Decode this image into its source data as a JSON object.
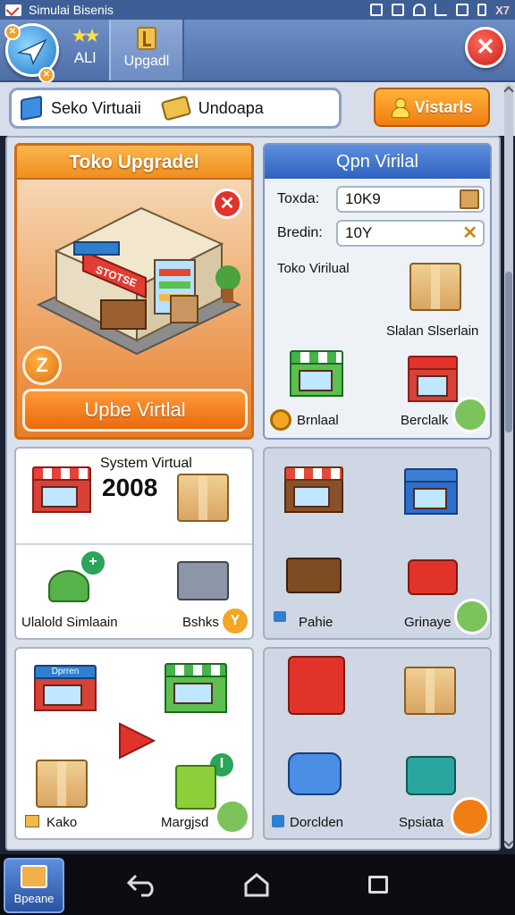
{
  "status_bar": {
    "title": "Simulai Bisenis",
    "time": "X7"
  },
  "header": {
    "tab_all": {
      "stars": "★★",
      "label": "ALl"
    },
    "tab_upgrade": {
      "label": "Upgadl"
    }
  },
  "search": {
    "placeholder": "Seko Virtuaii",
    "filter_label": "Undoapa"
  },
  "visitors_button": {
    "label": "Vistarls"
  },
  "toko_upgrade": {
    "title": "Toko Upgradel",
    "store_sign": "STOTSE",
    "coin_letter": "Z",
    "button_label": "Upbe Virtlal"
  },
  "open_virtual": {
    "title": "Qpn Virilal",
    "fields": [
      {
        "label": "Toxda:",
        "value": "10K9"
      },
      {
        "label": "Bredin:",
        "value": "10Y"
      }
    ],
    "section_label": "Toko Virilual",
    "item_caption": "Slalan Slserlain",
    "bottom_left_caption": "Brnlaal",
    "bottom_right_caption": "Berclalk"
  },
  "system_panel": {
    "title": "System Virtual",
    "year": "2008",
    "plus_left": "+",
    "left_caption": "Ulalold Simlaain",
    "right_caption": "Bshks",
    "badge": "Y"
  },
  "carts_panel": {
    "left_caption": "Pahie",
    "right_caption": "Grinaye"
  },
  "shops_panel": {
    "sign_label": "Dprren",
    "plus_label": "I",
    "left_caption": "Kako",
    "right_caption": "Margjsd"
  },
  "misc_panel": {
    "left_caption": "Dorclden",
    "right_caption": "Spsiata"
  },
  "navbar": {
    "home_app_label": "Bpeane"
  },
  "colors": {
    "accent_orange": "#ef8f20",
    "accent_blue": "#2f62bf",
    "close_red": "#c81e18"
  }
}
